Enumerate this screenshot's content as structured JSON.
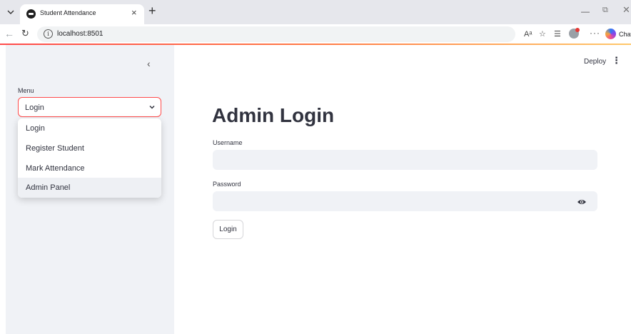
{
  "browser": {
    "tab_title": "Student Attendance",
    "tab_close": "×",
    "new_tab": "+",
    "url": "localhost:8501",
    "address_info": "i",
    "copilot_label": "Chat",
    "icons": [
      "tab-list-icon",
      "back-arrow-icon",
      "reload-icon",
      "info-icon",
      "read-aloud-icon",
      "favorite-star-icon",
      "collections-icon",
      "profile-icon",
      "more-icon",
      "copilot-icon",
      "minimize-icon",
      "restore-icon",
      "close-icon"
    ]
  },
  "sidebar": {
    "collapse": "‹",
    "menu_label": "Menu",
    "selected": "Login",
    "options": [
      "Login",
      "Register Student",
      "Mark Attendance",
      "Admin Panel"
    ],
    "hovered_option": "Admin Panel"
  },
  "header": {
    "deploy": "Deploy",
    "menu": "⋮"
  },
  "main": {
    "title": "Admin Login",
    "username_label": "Username",
    "username_value": "",
    "password_label": "Password",
    "password_value": "",
    "login_button": "Login"
  },
  "colors": {
    "accent": "#ff4b4b",
    "sidebar_bg": "#f0f2f6",
    "text": "#31333f"
  }
}
